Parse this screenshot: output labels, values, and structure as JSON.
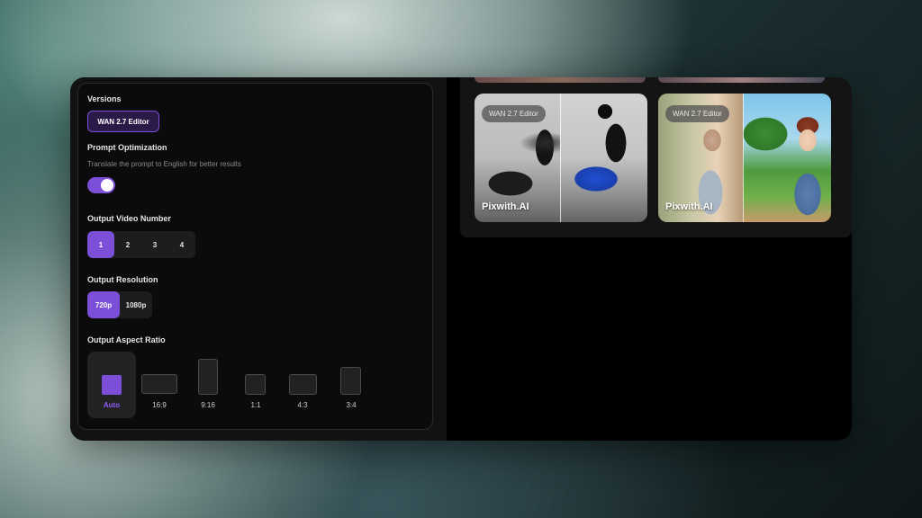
{
  "settings": {
    "versions": {
      "title": "Versions",
      "selected": "WAN 2.7 Editor"
    },
    "prompt_optimization": {
      "title": "Prompt Optimization",
      "description": "Translate the prompt to English for better results",
      "enabled": true
    },
    "output_video_number": {
      "title": "Output Video Number",
      "options": [
        "1",
        "2",
        "3",
        "4"
      ],
      "selected": "1"
    },
    "output_resolution": {
      "title": "Output Resolution",
      "options": [
        "720p",
        "1080p"
      ],
      "selected": "720p"
    },
    "output_aspect_ratio": {
      "title": "Output Aspect Ratio",
      "options": [
        "Auto",
        "16:9",
        "9:16",
        "1:1",
        "4:3",
        "3:4"
      ],
      "selected": "Auto"
    }
  },
  "gallery": {
    "cards": [
      {
        "badge": "WAN 2.7 Editor",
        "watermark": "Pixwith.AI"
      },
      {
        "badge": "WAN 2.7 Editor",
        "watermark": "Pixwith.AI"
      }
    ]
  },
  "colors": {
    "accent": "#7c4fd8",
    "panel": "#0b0b0b",
    "frame": "#000000"
  }
}
